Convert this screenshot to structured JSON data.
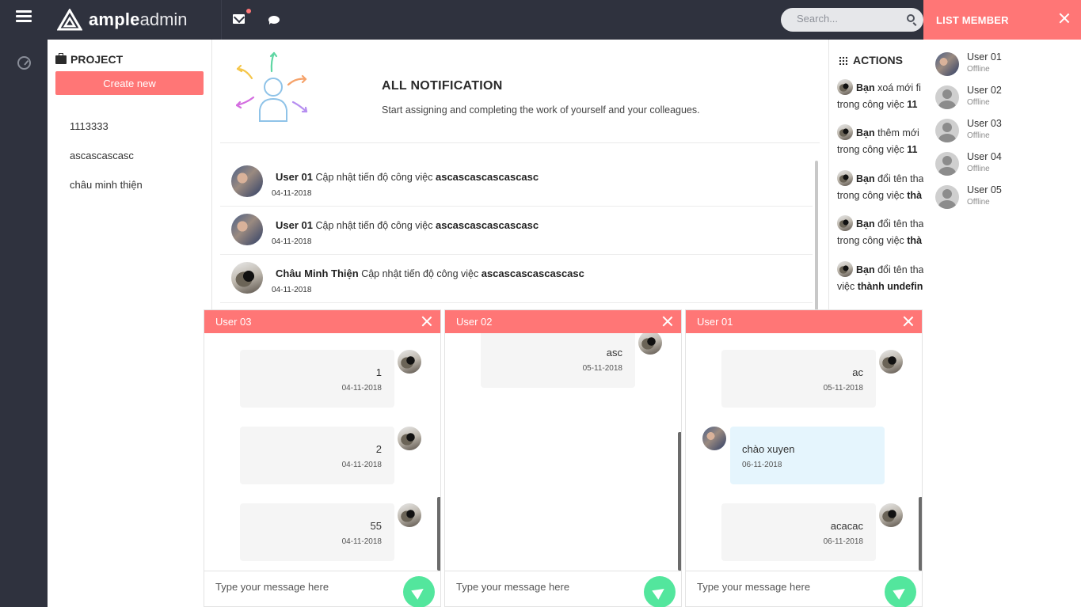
{
  "app": {
    "brand_bold": "ample",
    "brand_light": "admin"
  },
  "search": {
    "placeholder": "Search..."
  },
  "project": {
    "title": "PROJECT",
    "create_label": "Create new",
    "items": [
      "1113333",
      "ascascascasc",
      "châu minh thiện"
    ]
  },
  "notification": {
    "title": "ALL NOTIFICATION",
    "subtitle": "Start assigning and completing the work of yourself and your colleagues.",
    "items": [
      {
        "user": "User 01",
        "action": "Cập nhật tiến độ công việc",
        "target": "ascascascascascasc",
        "date": "04-11-2018"
      },
      {
        "user": "User 01",
        "action": "Cập nhật tiến độ công việc",
        "target": "ascascascascascasc",
        "date": "04-11-2018"
      },
      {
        "user": "Châu Minh Thiện",
        "action": "Cập nhật tiến độ công việc",
        "target": "ascascascascascasc",
        "date": "04-11-2018"
      }
    ]
  },
  "actions": {
    "title": "ACTIONS",
    "items": [
      {
        "who": "Bạn",
        "line1": "xoá mới fi",
        "line2_pre": "trong công việc",
        "line2_bold": "11"
      },
      {
        "who": "Bạn",
        "line1": "thêm mới",
        "line2_pre": "trong công việc",
        "line2_bold": "11"
      },
      {
        "who": "Bạn",
        "line1": "đổi tên tha",
        "line2_pre": "trong công việc",
        "line2_bold": "thà"
      },
      {
        "who": "Bạn",
        "line1": "đổi tên tha",
        "line2_pre": "trong công việc",
        "line2_bold": "thà"
      },
      {
        "who": "Bạn",
        "line1": "đổi tên tha",
        "line2_pre": "việc",
        "line2_bold": "thành undefin"
      }
    ]
  },
  "members": {
    "title": "LIST MEMBER",
    "items": [
      {
        "name": "User 01",
        "status": "Offline"
      },
      {
        "name": "User 02",
        "status": "Offline"
      },
      {
        "name": "User 03",
        "status": "Offline"
      },
      {
        "name": "User 04",
        "status": "Offline"
      },
      {
        "name": "User 05",
        "status": "Offline"
      }
    ]
  },
  "chats": [
    {
      "title": "User 03",
      "placeholder": "Type your message here",
      "messages": [
        {
          "text": "1",
          "date": "04-11-2018"
        },
        {
          "text": "2",
          "date": "04-11-2018"
        },
        {
          "text": "55",
          "date": "04-11-2018"
        }
      ]
    },
    {
      "title": "User 02",
      "placeholder": "Type your message here",
      "messages": [
        {
          "text": "asc",
          "date": "05-11-2018"
        }
      ]
    },
    {
      "title": "User 01",
      "placeholder": "Type your message here",
      "messages": [
        {
          "text": "ac",
          "date": "05-11-2018"
        },
        {
          "text": "chào xuyen",
          "date": "06-11-2018"
        },
        {
          "text": "acacac",
          "date": "06-11-2018"
        }
      ]
    }
  ],
  "colors": {
    "accent": "#ff7676",
    "dark": "#2f323e",
    "send": "#53e69d",
    "bubble_in": "#e5f5fd"
  }
}
